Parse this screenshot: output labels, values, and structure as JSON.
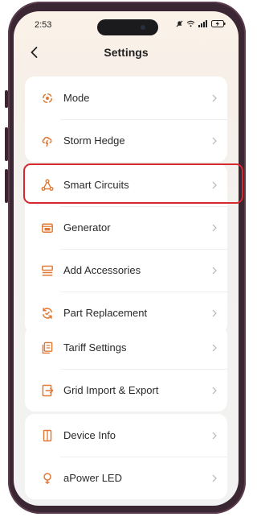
{
  "status_bar": {
    "time": "2:53"
  },
  "header": {
    "title": "Settings",
    "back_icon": "chevron-left-icon"
  },
  "groups": [
    {
      "items": [
        {
          "label": "Mode",
          "icon": "mode-icon"
        },
        {
          "label": "Storm Hedge",
          "icon": "storm-icon"
        }
      ]
    },
    {
      "items": [
        {
          "label": "Smart Circuits",
          "icon": "smart-circuits-icon",
          "highlighted": true
        },
        {
          "label": "Generator",
          "icon": "generator-icon"
        },
        {
          "label": "Add Accessories",
          "icon": "accessories-icon"
        },
        {
          "label": "Part Replacement",
          "icon": "part-replacement-icon"
        }
      ]
    },
    {
      "items": [
        {
          "label": "Tariff Settings",
          "icon": "tariff-icon"
        },
        {
          "label": "Grid Import & Export",
          "icon": "grid-icon"
        }
      ]
    },
    {
      "items": [
        {
          "label": "Device Info",
          "icon": "device-info-icon"
        },
        {
          "label": "aPower LED",
          "icon": "led-icon"
        }
      ]
    }
  ],
  "colors": {
    "accent_orange": "#e07a36",
    "highlight_red": "#d6282f"
  }
}
